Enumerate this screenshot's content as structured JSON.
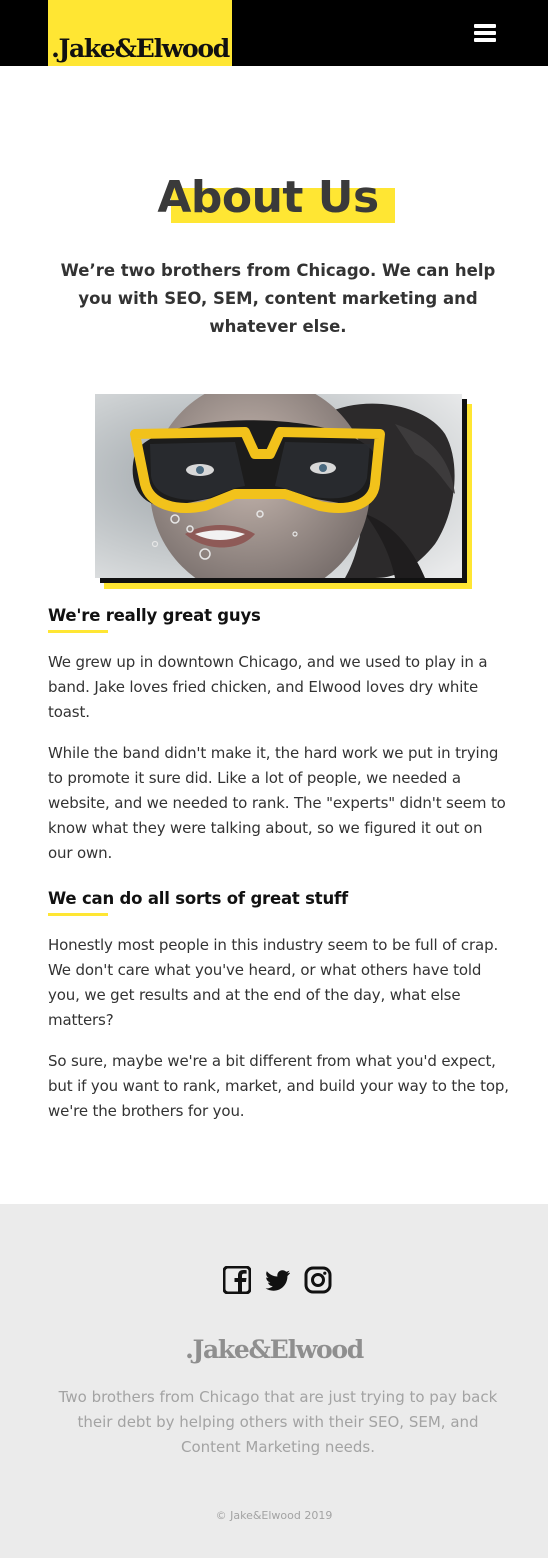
{
  "header": {
    "logo": ".Jake&Elwood",
    "menu_icon": "hamburger-menu-icon"
  },
  "hero": {
    "title": "About Us",
    "intro": "We’re two brothers from Chicago. We can help you with SEO, SEM, content marketing and whatever else."
  },
  "photo": {
    "subject": "woman-underwater-yellow-diving-mask"
  },
  "sections": [
    {
      "heading": "We're really great guys",
      "paragraphs": [
        "We grew up in downtown Chicago, and we used to play in a band. Jake loves fried chicken, and Elwood loves dry white toast.",
        "While the band didn't make it, the hard work we put in trying to promote it sure did. Like a lot of people, we needed a website, and we needed to rank. The \"experts\" didn't seem to know what they were talking about, so we figured it out on our own."
      ]
    },
    {
      "heading": "We can do all sorts of great stuff",
      "paragraphs": [
        "Honestly most people in this industry seem to be full of crap. We don't care what you've heard, or what others have told you, we get results and at the end of the day, what else matters?",
        "So sure, maybe we're a bit different from what you'd expect, but if you want to rank, market, and build your way to the top, we're the brothers for you."
      ]
    }
  ],
  "footer": {
    "social_icons": [
      "facebook-icon",
      "twitter-icon",
      "instagram-icon"
    ],
    "logo": ".Jake&Elwood",
    "description": "Two brothers from Chicago that are just trying to pay back their debt by helping others with their SEO, SEM, and Content Marketing needs.",
    "copyright": "© Jake&Elwood 2019"
  },
  "colors": {
    "accent": "#ffe633",
    "header_bg": "#000000",
    "footer_bg": "#ebebeb"
  }
}
